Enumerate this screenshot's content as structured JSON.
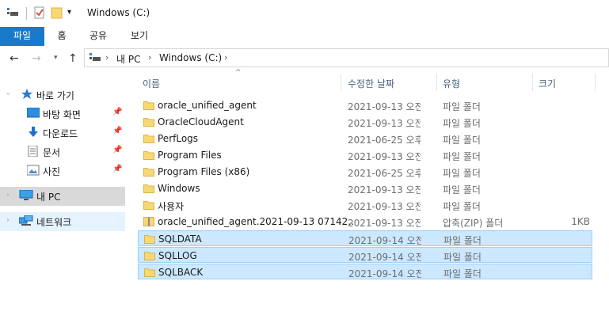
{
  "window": {
    "title": "Windows (C:)"
  },
  "ribbon": {
    "tabs": [
      "파일",
      "홈",
      "공유",
      "보기"
    ]
  },
  "address": {
    "breadcrumbs": [
      "내 PC",
      "Windows (C:)"
    ]
  },
  "nav": {
    "items": [
      {
        "label": "바로 가기",
        "icon": "star-icon"
      },
      {
        "label": "바탕 화면",
        "icon": "desktop-icon",
        "pinned": true
      },
      {
        "label": "다운로드",
        "icon": "download-icon",
        "pinned": true
      },
      {
        "label": "문서",
        "icon": "document-icon",
        "pinned": true
      },
      {
        "label": "사진",
        "icon": "pictures-icon",
        "pinned": true
      },
      {
        "label": "내 PC",
        "icon": "computer-icon"
      },
      {
        "label": "네트워크",
        "icon": "network-icon"
      }
    ]
  },
  "columns": {
    "name": "이름",
    "date": "수정한 날짜",
    "type": "유형",
    "size": "크기"
  },
  "files": [
    {
      "name": "oracle_unified_agent",
      "date": "2021-09-13 오전...",
      "type": "파일 폴더",
      "size": ""
    },
    {
      "name": "OracleCloudAgent",
      "date": "2021-09-13 오전...",
      "type": "파일 폴더",
      "size": ""
    },
    {
      "name": "PerfLogs",
      "date": "2021-06-25 오후...",
      "type": "파일 폴더",
      "size": ""
    },
    {
      "name": "Program Files",
      "date": "2021-09-13 오전...",
      "type": "파일 폴더",
      "size": ""
    },
    {
      "name": "Program Files (x86)",
      "date": "2021-06-25 오후...",
      "type": "파일 폴더",
      "size": ""
    },
    {
      "name": "Windows",
      "date": "2021-09-13 오전...",
      "type": "파일 폴더",
      "size": ""
    },
    {
      "name": "사용자",
      "date": "2021-09-13 오전...",
      "type": "파일 폴더",
      "size": ""
    },
    {
      "name": "oracle_unified_agent.2021-09-13 07142...",
      "date": "2021-09-13 오전...",
      "type": "압축(ZIP) 폴더",
      "size": "1KB",
      "zip": true
    },
    {
      "name": "SQLDATA",
      "date": "2021-09-14 오전...",
      "type": "파일 폴더",
      "size": "",
      "selected": true
    },
    {
      "name": "SQLLOG",
      "date": "2021-09-14 오전...",
      "type": "파일 폴더",
      "size": "",
      "selected": true
    },
    {
      "name": "SQLBACK",
      "date": "2021-09-14 오전...",
      "type": "파일 폴더",
      "size": "",
      "selected": true
    }
  ],
  "colors": {
    "accent": "#1979ca",
    "selection": "#cce8ff",
    "selection_border": "#99d1ff",
    "folder": "#f8d775"
  }
}
